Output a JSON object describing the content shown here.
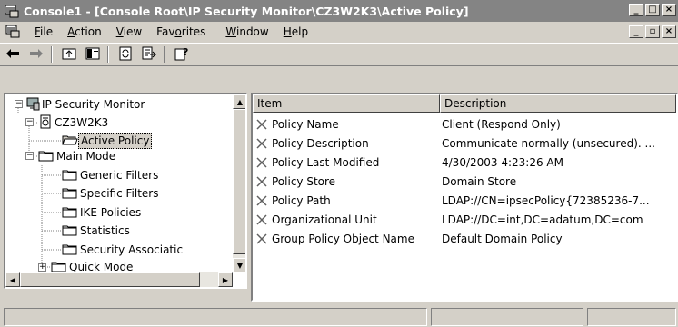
{
  "window": {
    "title": "Console1 - [Console Root\\IP Security Monitor\\CZ3W2K3\\Active Policy]",
    "app_icon": "mmc-console-icon",
    "controls": [
      "minimize",
      "maximize",
      "close"
    ]
  },
  "menubar": {
    "items": [
      {
        "label": "File",
        "mnemonic": "F"
      },
      {
        "label": "Action",
        "mnemonic": "A"
      },
      {
        "label": "View",
        "mnemonic": "V"
      },
      {
        "label": "Favorites",
        "mnemonic": "o"
      },
      {
        "label": "Window",
        "mnemonic": "W"
      },
      {
        "label": "Help",
        "mnemonic": "H"
      }
    ]
  },
  "toolbar": {
    "buttons": [
      "back-arrow-icon",
      "forward-arrow-icon",
      "up-folder-icon",
      "show-hide-tree-icon",
      "refresh-icon",
      "export-list-icon",
      "help-icon"
    ]
  },
  "tree": {
    "nodes": [
      {
        "label": "IP Security Monitor",
        "icon": "monitor-icon",
        "expander": "−"
      },
      {
        "label": "CZ3W2K3",
        "icon": "computer-icon",
        "expander": "−"
      },
      {
        "label": "Active Policy",
        "icon": "folder-open-icon",
        "selected": true
      },
      {
        "label": "Main Mode",
        "icon": "folder-icon",
        "expander": "−"
      },
      {
        "label": "Generic Filters",
        "icon": "folder-icon"
      },
      {
        "label": "Specific Filters",
        "icon": "folder-icon"
      },
      {
        "label": "IKE Policies",
        "icon": "folder-icon"
      },
      {
        "label": "Statistics",
        "icon": "folder-icon"
      },
      {
        "label": "Security Associatic",
        "icon": "folder-icon"
      },
      {
        "label": "Quick Mode",
        "icon": "folder-icon",
        "expander": "+"
      }
    ]
  },
  "list": {
    "columns": [
      "Item",
      "Description"
    ],
    "rows": [
      {
        "item": "Policy Name",
        "description": "Client (Respond Only)"
      },
      {
        "item": "Policy Description",
        "description": "Communicate normally (unsecured). ..."
      },
      {
        "item": "Policy Last Modified",
        "description": "4/30/2003 4:23:26 AM"
      },
      {
        "item": "Policy Store",
        "description": "Domain Store"
      },
      {
        "item": "Policy Path",
        "description": "LDAP://CN=ipsecPolicy{72385236-7..."
      },
      {
        "item": "Organizational Unit",
        "description": "LDAP://DC=int,DC=adatum,DC=com"
      },
      {
        "item": "Group Policy Object Name",
        "description": "Default Domain Policy"
      }
    ]
  },
  "colors": {
    "titlebar_inactive": "#848484",
    "face": "#d4d0c8"
  }
}
